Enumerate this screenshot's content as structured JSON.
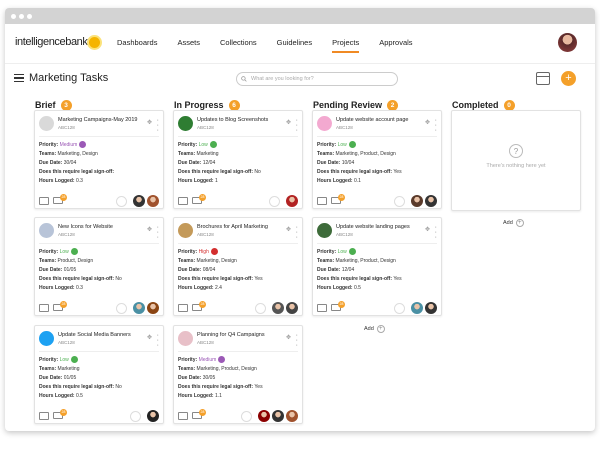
{
  "header": {
    "logo": "intelligencebank",
    "nav": [
      {
        "label": "Dashboards"
      },
      {
        "label": "Assets"
      },
      {
        "label": "Collections"
      },
      {
        "label": "Guidelines"
      },
      {
        "label": "Projects",
        "active": true
      },
      {
        "label": "Approvals"
      }
    ]
  },
  "page": {
    "title": "Marketing Tasks",
    "search_placeholder": "What are you looking for?",
    "add_label": "+"
  },
  "labels": {
    "priority": "Priority:",
    "teams": "Teams:",
    "due": "Due Date:",
    "legal": "Does this require legal sign-off:",
    "hours": "Hours Logged:",
    "add": "Add",
    "nothing": "There's nothing here yet",
    "qmark": "?"
  },
  "columns": [
    {
      "name": "Brief",
      "count": "3",
      "cards": [
        {
          "title": "Marketing Campaigns-May 2019",
          "id": "ABC128",
          "priority": "Medium",
          "pcolor": "#9b59b6",
          "teams": "Marketing, Design",
          "due": "30/04",
          "legal": "",
          "hours": "0.3",
          "badge": "28",
          "thumb": "#d9d9d9"
        },
        {
          "title": "New Icons for Website",
          "id": "ABC128",
          "priority": "Low",
          "pcolor": "#4caf50",
          "teams": "Product, Design",
          "due": "01/05",
          "legal": "No",
          "hours": "0.3",
          "badge": "28",
          "thumb": "#b8c4d8"
        },
        {
          "title": "Update Social Media Banners",
          "id": "ABC128",
          "priority": "Low",
          "pcolor": "#4caf50",
          "teams": "Marketing",
          "due": "01/05",
          "legal": "No",
          "hours": "0.5",
          "badge": "28",
          "thumb": "#1da1f2"
        }
      ]
    },
    {
      "name": "In Progress",
      "count": "6",
      "cards": [
        {
          "title": "Updates to Blog Screenshots",
          "id": "ABC128",
          "priority": "Low",
          "pcolor": "#4caf50",
          "teams": "Marketing",
          "due": "12/04",
          "legal": "No",
          "hours": "1",
          "badge": "28",
          "thumb": "#2e7d32"
        },
        {
          "title": "Brochures for April Marketing",
          "id": "ABC128",
          "priority": "High",
          "pcolor": "#d32f2f",
          "teams": "Marketing, Design",
          "due": "08/04",
          "legal": "Yes",
          "hours": "2.4",
          "badge": "28",
          "thumb": "#c49a5a"
        },
        {
          "title": "Planning for Q4 Campaigns",
          "id": "ABC128",
          "priority": "Medium",
          "pcolor": "#9b59b6",
          "teams": "Marketing, Product, Design",
          "due": "30/05",
          "legal": "Yes",
          "hours": "1.1",
          "badge": "28",
          "thumb": "#e8c0c8"
        }
      ]
    },
    {
      "name": "Pending Review",
      "count": "2",
      "cards": [
        {
          "title": "Update website account page",
          "id": "ABC128",
          "priority": "Low",
          "pcolor": "#4caf50",
          "teams": "Marketing, Product, Design",
          "due": "10/04",
          "legal": "Yes",
          "hours": "0.1",
          "badge": "28",
          "thumb": "#f3a9d0"
        },
        {
          "title": "Update website landing pages",
          "id": "ABC128",
          "priority": "Low",
          "pcolor": "#4caf50",
          "teams": "Marketing, Product, Design",
          "due": "12/04",
          "legal": "Yes",
          "hours": "0.5",
          "badge": "28",
          "thumb": "#3e6b3a"
        }
      ]
    },
    {
      "name": "Completed",
      "count": "0",
      "cards": []
    }
  ]
}
